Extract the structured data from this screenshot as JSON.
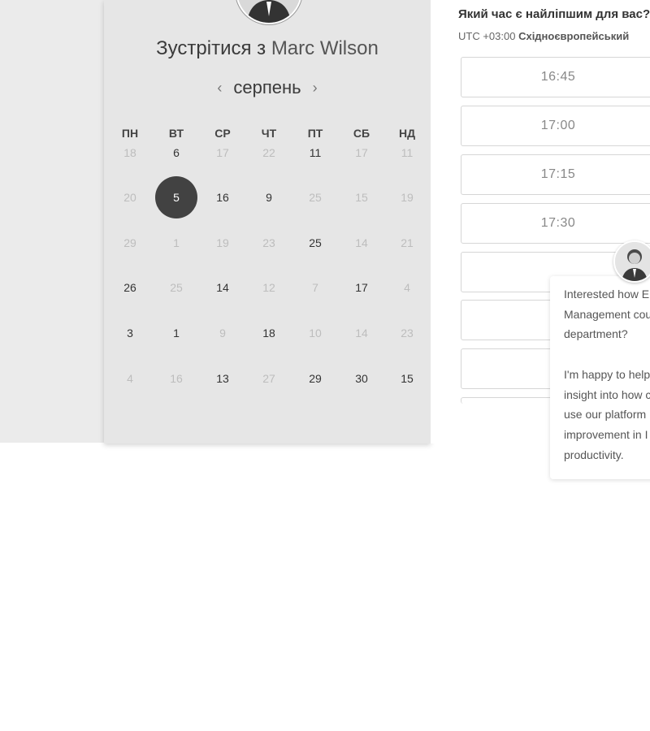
{
  "meeting": {
    "title_prefix": "Зустрітися з",
    "host_name": "Marc Wilson"
  },
  "calendar": {
    "month": "серпень",
    "weekdays": [
      "ПН",
      "ВТ",
      "СР",
      "ЧТ",
      "ПТ",
      "СБ",
      "НД"
    ],
    "rows": [
      [
        "18",
        "6",
        "17",
        "22",
        "11",
        "17",
        "11"
      ],
      [
        "20",
        "5",
        "16",
        "9",
        "25",
        "15",
        "19"
      ],
      [
        "29",
        "1",
        "19",
        "23",
        "25",
        "14",
        "21"
      ],
      [
        "26",
        "25",
        "14",
        "12",
        "7",
        "17",
        "4"
      ],
      [
        "3",
        "1",
        "9",
        "18",
        "10",
        "14",
        "23"
      ],
      [
        "4",
        "16",
        "13",
        "27",
        "29",
        "30",
        "15"
      ]
    ],
    "available": [
      [
        false,
        true,
        false,
        false,
        true,
        false,
        false
      ],
      [
        false,
        true,
        true,
        true,
        false,
        false,
        false
      ],
      [
        false,
        false,
        false,
        false,
        true,
        false,
        false
      ],
      [
        true,
        false,
        true,
        false,
        false,
        true,
        false
      ],
      [
        true,
        true,
        false,
        true,
        false,
        false,
        false
      ],
      [
        false,
        false,
        true,
        false,
        true,
        true,
        true
      ]
    ],
    "selected": {
      "row": 1,
      "col": 1
    }
  },
  "times": {
    "title": "Який час є найліпшим для вас?",
    "tz_offset": "UTC +03:00",
    "tz_name": "Східноєвропейський",
    "slots": [
      "16:45",
      "17:00",
      "17:15",
      "17:30",
      "",
      "",
      "",
      ""
    ]
  },
  "chat": {
    "message": "Interested how E\nManagement cou\ndepartment?\n\nI'm happy to help\ninsight into how c\nuse our platform\nimprovement in I\nproductivity."
  }
}
